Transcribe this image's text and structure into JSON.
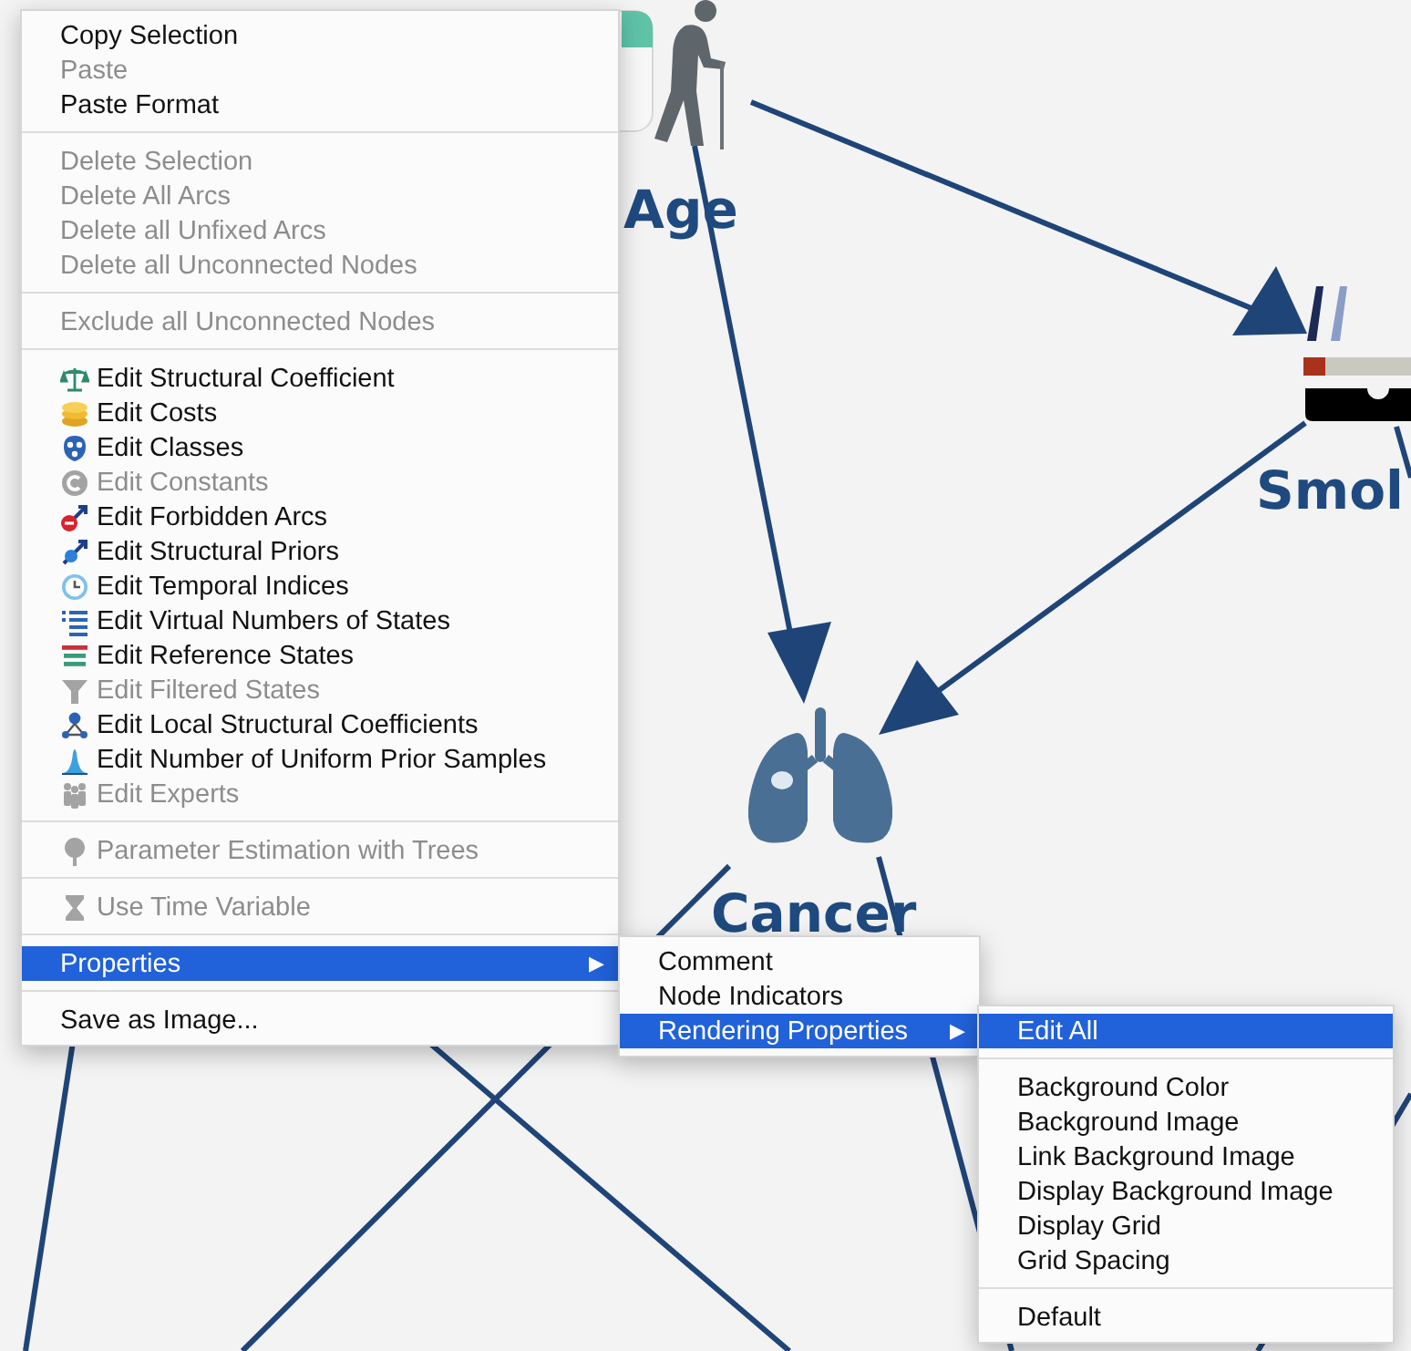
{
  "canvas": {
    "nodes": [
      {
        "label": "Age"
      },
      {
        "label": "Smol"
      },
      {
        "label": "Cancer"
      }
    ]
  },
  "context_menu": {
    "sections": [
      {
        "items": [
          {
            "kind": "plain",
            "label": "Copy Selection",
            "disabled": false,
            "selected": false
          },
          {
            "kind": "plain",
            "label": "Paste",
            "disabled": true,
            "selected": false
          },
          {
            "kind": "plain",
            "label": "Paste Format",
            "disabled": false,
            "selected": false
          }
        ]
      },
      {
        "items": [
          {
            "kind": "plain",
            "label": "Delete Selection",
            "disabled": true,
            "selected": false
          },
          {
            "kind": "plain",
            "label": "Delete All Arcs",
            "disabled": true,
            "selected": false
          },
          {
            "kind": "plain",
            "label": "Delete all Unfixed Arcs",
            "disabled": true,
            "selected": false
          },
          {
            "kind": "plain",
            "label": "Delete all Unconnected Nodes",
            "disabled": true,
            "selected": false
          }
        ]
      },
      {
        "items": [
          {
            "kind": "plain",
            "label": "Exclude all Unconnected Nodes",
            "disabled": true,
            "selected": false
          }
        ]
      },
      {
        "items": [
          {
            "kind": "icon_item",
            "label": "Edit Structural Coefficient",
            "disabled": false,
            "selected": false
          },
          {
            "kind": "icon_item",
            "label": "Edit Costs",
            "disabled": false,
            "selected": false
          },
          {
            "kind": "icon_item",
            "label": "Edit Classes",
            "disabled": false,
            "selected": false
          },
          {
            "kind": "icon_item",
            "label": "Edit Constants",
            "disabled": true,
            "selected": false
          },
          {
            "kind": "icon_item",
            "label": "Edit Forbidden Arcs",
            "disabled": false,
            "selected": false
          },
          {
            "kind": "icon_item",
            "label": "Edit Structural Priors",
            "disabled": false,
            "selected": false
          },
          {
            "kind": "icon_item",
            "label": "Edit Temporal Indices",
            "disabled": false,
            "selected": false
          },
          {
            "kind": "icon_item",
            "label": "Edit Virtual Numbers of States",
            "disabled": false,
            "selected": false
          },
          {
            "kind": "icon_item",
            "label": "Edit Reference States",
            "disabled": false,
            "selected": false
          },
          {
            "kind": "icon_item",
            "label": "Edit Filtered States",
            "disabled": true,
            "selected": false
          },
          {
            "kind": "icon_item",
            "label": "Edit Local Structural Coefficients",
            "disabled": false,
            "selected": false
          },
          {
            "kind": "icon_item",
            "label": "Edit Number of Uniform Prior Samples",
            "disabled": false,
            "selected": false
          },
          {
            "kind": "icon_item",
            "label": "Edit Experts",
            "disabled": true,
            "selected": false
          }
        ]
      },
      {
        "items": [
          {
            "kind": "icon_item",
            "label": "Parameter Estimation with Trees",
            "disabled": true,
            "selected": false
          }
        ]
      },
      {
        "items": [
          {
            "kind": "icon_item",
            "label": "Use Time Variable",
            "disabled": true,
            "selected": false
          }
        ]
      },
      {
        "items": [
          {
            "kind": "plain",
            "label": "Properties",
            "disabled": false,
            "selected": true,
            "arrow": "▶"
          }
        ]
      },
      {
        "items": [
          {
            "kind": "plain",
            "label": "Save as Image...",
            "disabled": false,
            "selected": false
          }
        ]
      }
    ]
  },
  "properties_submenu": {
    "items": [
      {
        "label": "Comment",
        "selected": false
      },
      {
        "label": "Node Indicators",
        "selected": false
      },
      {
        "label": "Rendering Properties",
        "selected": true,
        "arrow": "▶"
      }
    ]
  },
  "rendering_submenu": {
    "sections": [
      {
        "items": [
          {
            "label": "Edit All",
            "selected": true
          }
        ]
      },
      {
        "items": [
          {
            "label": "Background Color",
            "selected": false
          },
          {
            "label": "Background Image",
            "selected": false
          },
          {
            "label": "Link Background Image",
            "selected": false
          },
          {
            "label": "Display Background Image",
            "selected": false
          },
          {
            "label": "Display Grid",
            "selected": false
          },
          {
            "label": "Grid Spacing",
            "selected": false
          }
        ]
      },
      {
        "items": [
          {
            "label": "Default",
            "selected": false
          }
        ]
      }
    ]
  }
}
